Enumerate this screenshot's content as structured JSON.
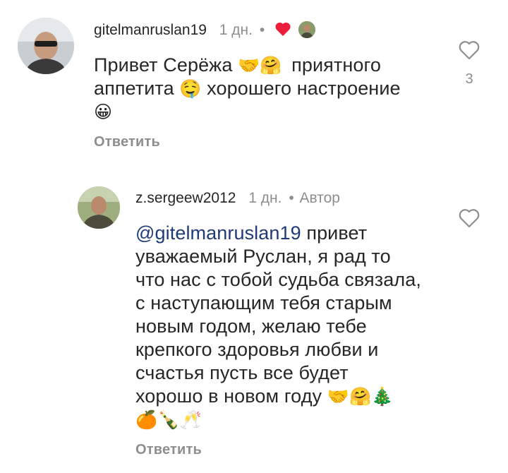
{
  "comments": [
    {
      "username": "gitelmanruslan19",
      "time": "1 дн.",
      "separator": "•",
      "heart_icon": "heart-filled-red",
      "body": {
        "line1": "Привет Серёжа",
        "emoji1": "🤝",
        "emoji2": "🤗",
        "line1b": "приятного",
        "line2": "аппетита",
        "emoji3": "🤤",
        "line2b": "хорошего настроение",
        "emoji4": "😀"
      },
      "reply_label": "Ответить",
      "like_count": "3"
    },
    {
      "username": "z.sergeew2012",
      "time": "1 дн.",
      "separator": "•",
      "author_label": "Автор",
      "mention": "@gitelmanruslan19",
      "body": {
        "line1": "привет",
        "line2": "уважаемый Руслан, я рад то",
        "line3": "что нас с тобой судьба связала,",
        "line4": "с наступающим тебя старым",
        "line5": "новым годом, желаю тебе",
        "line6": "крепкого здоровья любви и",
        "line7": "счастья пусть все будет",
        "line8": "хорошо в новом году",
        "emoji1": "🤝",
        "emoji2": "🤗",
        "emoji3": "🎄",
        "emoji4": "🍊",
        "emoji5": "🍾",
        "emoji6": "🥂"
      },
      "reply_label": "Ответить"
    }
  ]
}
